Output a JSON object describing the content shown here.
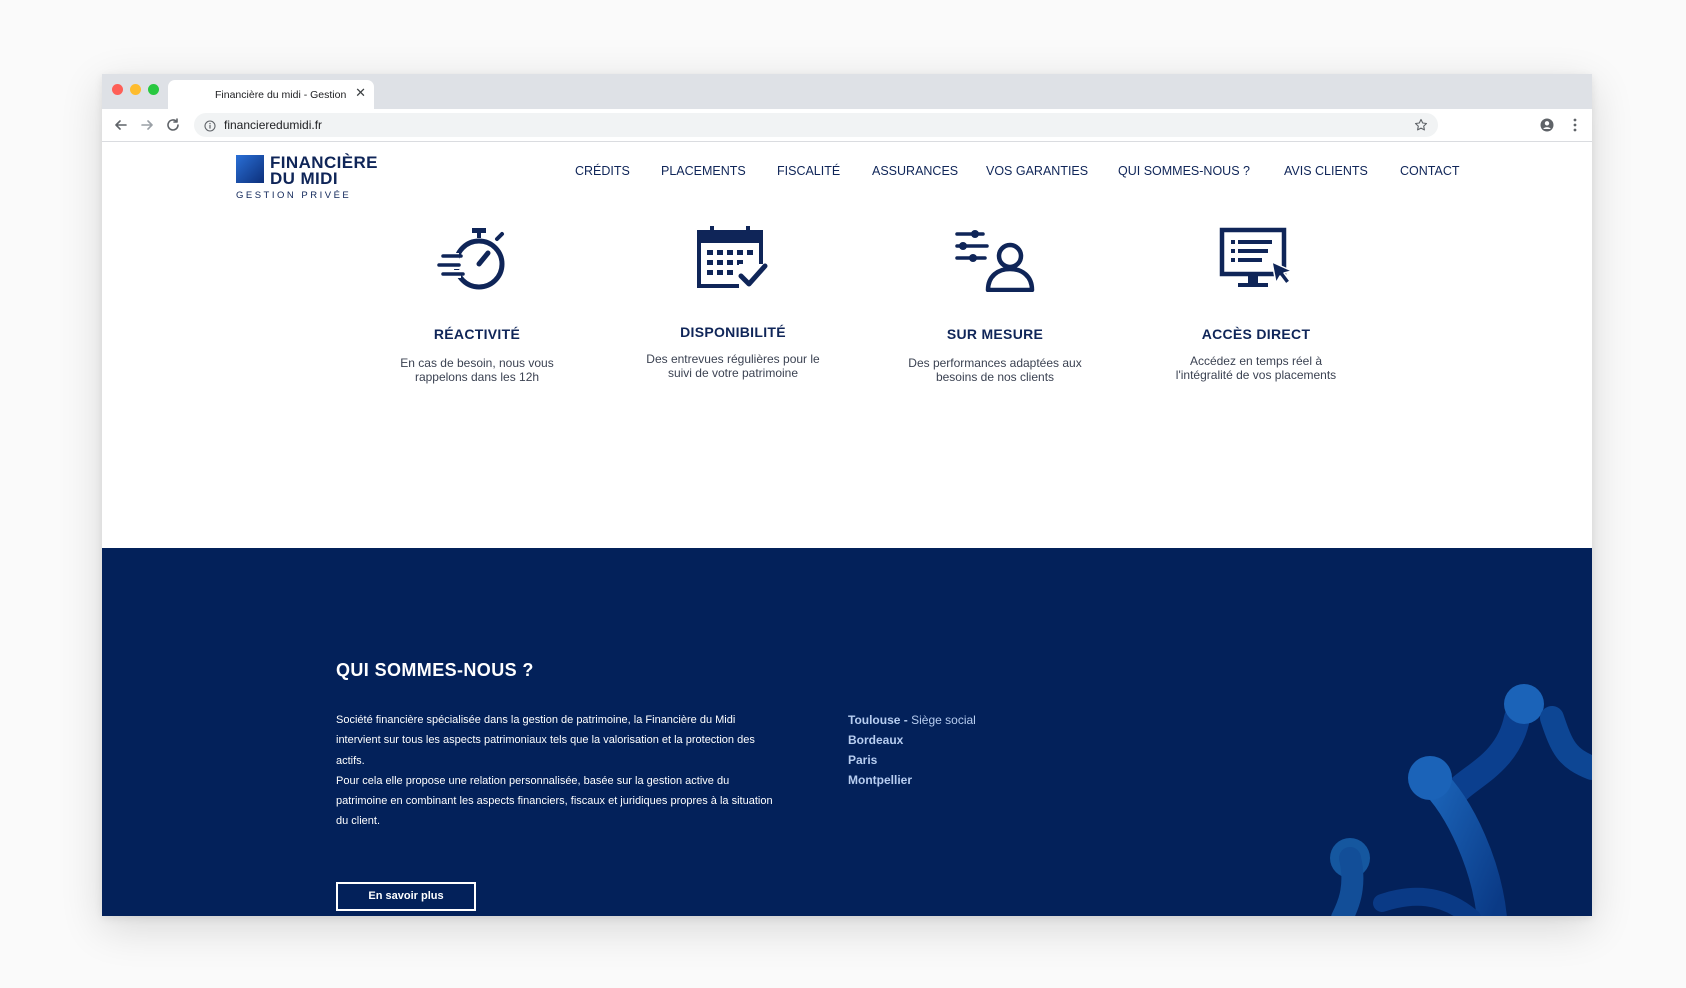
{
  "browser": {
    "tab_title": "Financière du midi - Gestion",
    "url": "financieredumidi.fr"
  },
  "logo": {
    "line1": "FINANCIÈRE",
    "line2": "DU MIDI",
    "line3": "GESTION PRIVÉE"
  },
  "nav": {
    "items": [
      {
        "label": "CRÉDITS"
      },
      {
        "label": "PLACEMENTS"
      },
      {
        "label": "FISCALITÉ"
      },
      {
        "label": "ASSURANCES"
      },
      {
        "label": "VOS GARANTIES"
      },
      {
        "label": "QUI SOMMES-NOUS ?"
      },
      {
        "label": "AVIS CLIENTS"
      },
      {
        "label": "CONTACT"
      }
    ]
  },
  "features": [
    {
      "title": "RÉACTIVITÉ",
      "desc": "En cas de besoin, nous vous rappelons dans les 12h",
      "icon": "stopwatch-icon"
    },
    {
      "title": "DISPONIBILITÉ",
      "desc": "Des entrevues régulières pour le suivi de votre patrimoine",
      "icon": "calendar-check-icon"
    },
    {
      "title": "SUR MESURE",
      "desc": "Des performances adaptées aux besoins de nos clients",
      "icon": "user-settings-icon"
    },
    {
      "title": "ACCÈS DIRECT",
      "desc": "Accédez en temps réel à l'intégralité de vos placements",
      "icon": "monitor-cursor-icon"
    }
  ],
  "about": {
    "title": "QUI SOMMES-NOUS ?",
    "paragraph1": "Société financière spécialisée dans la gestion de patrimoine, la Financière du Midi intervient sur tous les aspects patrimoniaux tels que la valorisation et la protection des actifs.",
    "paragraph2": "Pour cela elle propose une relation personnalisée, basée sur la gestion active du patrimoine en combinant les aspects financiers, fiscaux et juridiques propres à la situation du client.",
    "cities": [
      {
        "name": "Toulouse",
        "note": "Siège social"
      },
      {
        "name": "Bordeaux"
      },
      {
        "name": "Paris"
      },
      {
        "name": "Montpellier"
      }
    ],
    "cta_label": "En savoir plus"
  },
  "colors": {
    "navy": "#0f2558",
    "band": "#03215a",
    "accent_blue": "#1b63b8"
  }
}
